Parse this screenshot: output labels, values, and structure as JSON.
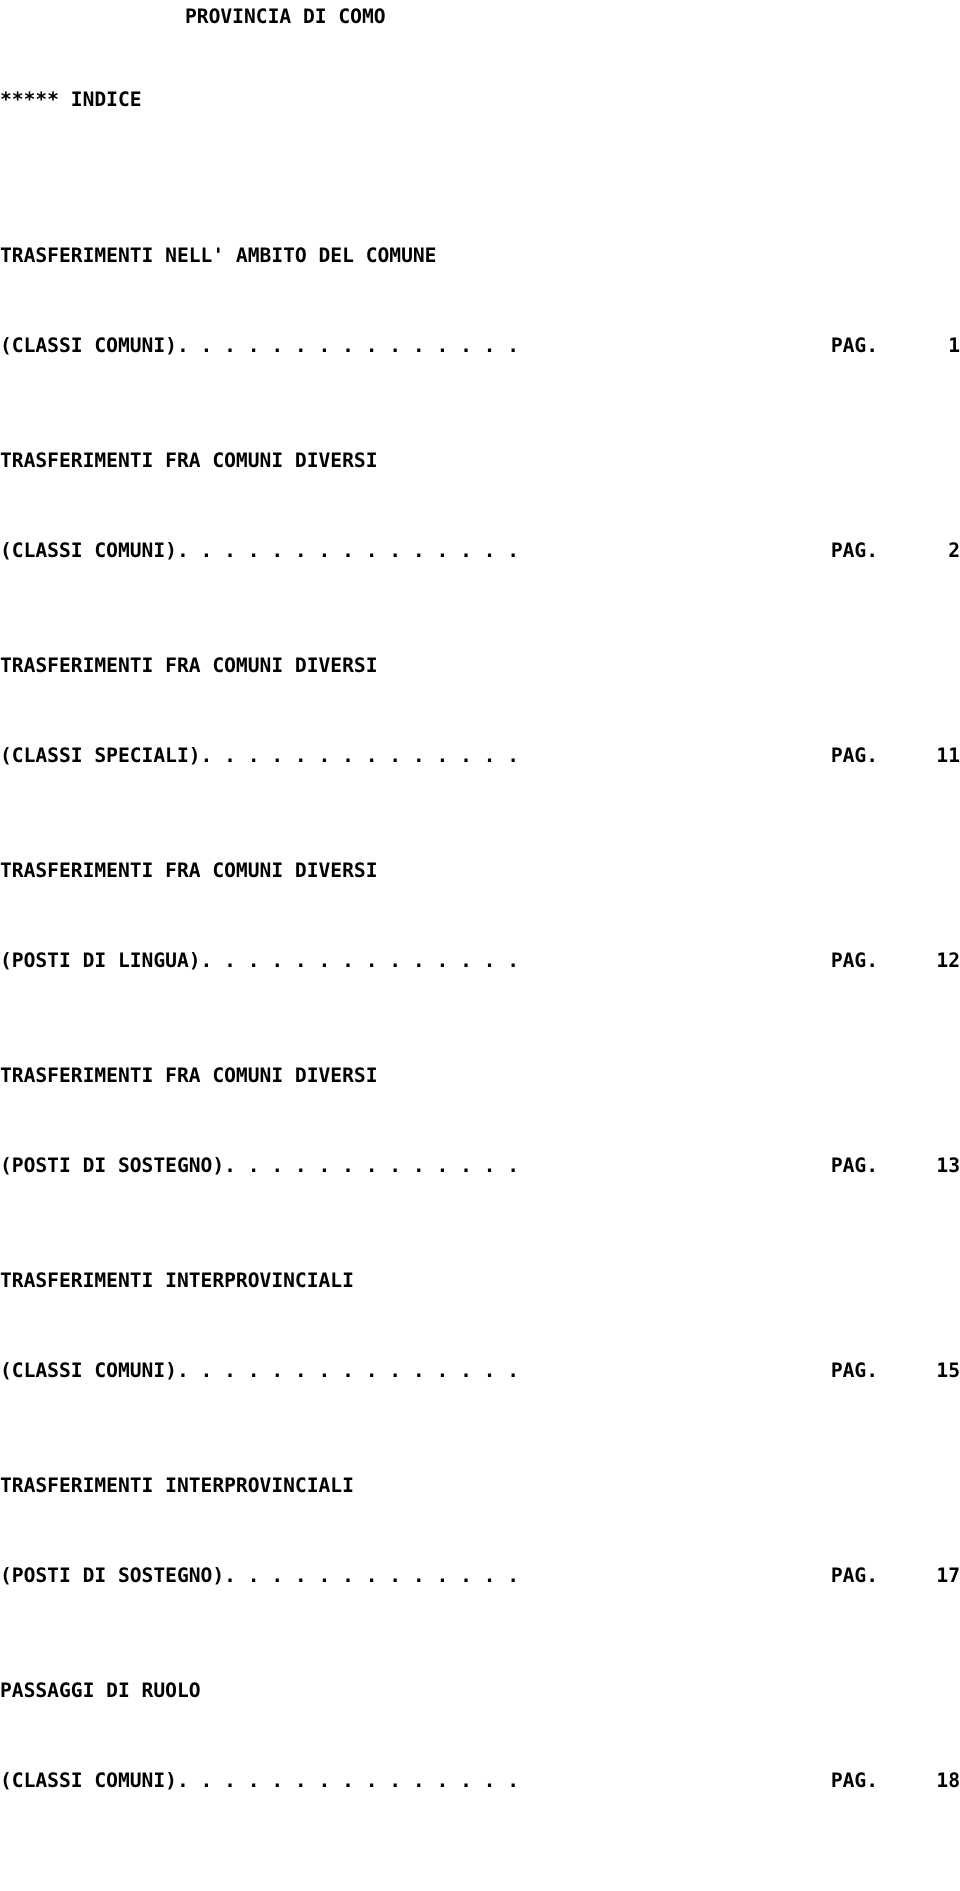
{
  "document": {
    "province_title": "PROVINCIA DI COMO",
    "index_title": "***** INDICE",
    "pag_label": "PAG.",
    "leader_dot": ".",
    "text_color": "#000000",
    "background_color": "#ffffff"
  },
  "entries": [
    {
      "heading": "TRASFERIMENTI NELL' AMBITO DEL COMUNE",
      "label": "(CLASSI COMUNI)",
      "leader": ". . . . . . . . . . . . . . .",
      "pag": "PAG.",
      "page": "1"
    },
    {
      "heading": "TRASFERIMENTI FRA COMUNI DIVERSI",
      "label": "(CLASSI COMUNI)",
      "leader": ". . . . . . . . . . . . . . .",
      "pag": "PAG.",
      "page": "2"
    },
    {
      "heading": "TRASFERIMENTI FRA COMUNI DIVERSI",
      "label": "(CLASSI SPECIALI)",
      "leader": ". . . . . . . . . . . . . .",
      "pag": "PAG.",
      "page": "11"
    },
    {
      "heading": "TRASFERIMENTI FRA COMUNI DIVERSI",
      "label": "(POSTI DI LINGUA)",
      "leader": ". . . . . . . . . . . . . .",
      "pag": "PAG.",
      "page": "12"
    },
    {
      "heading": "TRASFERIMENTI FRA COMUNI DIVERSI",
      "label": "(POSTI DI SOSTEGNO)",
      "leader": ". . . . . . . . . . . . .",
      "pag": "PAG.",
      "page": "13"
    },
    {
      "heading": "TRASFERIMENTI INTERPROVINCIALI",
      "label": "(CLASSI COMUNI)",
      "leader": ". . . . . . . . . . . . . . .",
      "pag": "PAG.",
      "page": "15"
    },
    {
      "heading": "TRASFERIMENTI INTERPROVINCIALI",
      "label": "(POSTI DI SOSTEGNO)",
      "leader": ". . . . . . . . . . . . .",
      "pag": "PAG.",
      "page": "17"
    },
    {
      "heading": "PASSAGGI DI RUOLO",
      "label": "(CLASSI COMUNI)",
      "leader": ". . . . . . . . . . . . . . .",
      "pag": "PAG.",
      "page": "18"
    }
  ]
}
